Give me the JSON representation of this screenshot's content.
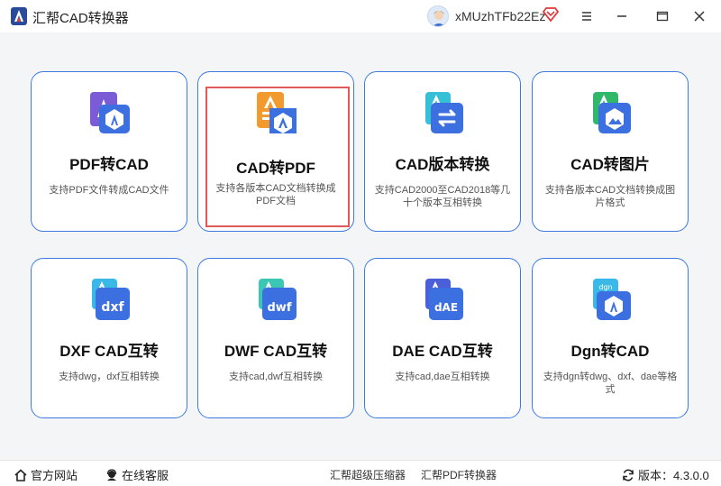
{
  "app": {
    "title": "汇帮CAD转换器",
    "username": "xMUzhTFb22Ez"
  },
  "colors": {
    "card_border": "#3f7ae0",
    "selection": "#e05a5a",
    "main_bg": "#f4f5f7"
  },
  "cards": [
    {
      "title": "PDF转CAD",
      "desc": "支持PDF文件转成CAD文件",
      "icon": "pdf-to-cad-icon"
    },
    {
      "title": "CAD转PDF",
      "desc": "支持各版本CAD文档转换成PDF文档",
      "icon": "cad-to-pdf-icon",
      "selected": true
    },
    {
      "title": "CAD版本转换",
      "desc": "支持CAD2000至CAD2018等几十个版本互相转换",
      "icon": "cad-version-icon"
    },
    {
      "title": "CAD转图片",
      "desc": "支持各版本CAD文档转换成图片格式",
      "icon": "cad-to-image-icon"
    },
    {
      "title": "DXF CAD互转",
      "desc": "支持dwg，dxf互相转换",
      "icon": "dxf-icon"
    },
    {
      "title": "DWF CAD互转",
      "desc": "支持cad,dwf互相转换",
      "icon": "dwf-icon"
    },
    {
      "title": "DAE CAD互转",
      "desc": "支持cad,dae互相转换",
      "icon": "dae-icon"
    },
    {
      "title": "Dgn转CAD",
      "desc": "支持dgn转dwg、dxf、dae等格式",
      "icon": "dgn-icon"
    }
  ],
  "footer": {
    "website": "官方网站",
    "support": "在线客服",
    "link1": "汇帮超级压缩器",
    "link2": "汇帮PDF转换器",
    "version": "版本：4.3.0.0"
  }
}
